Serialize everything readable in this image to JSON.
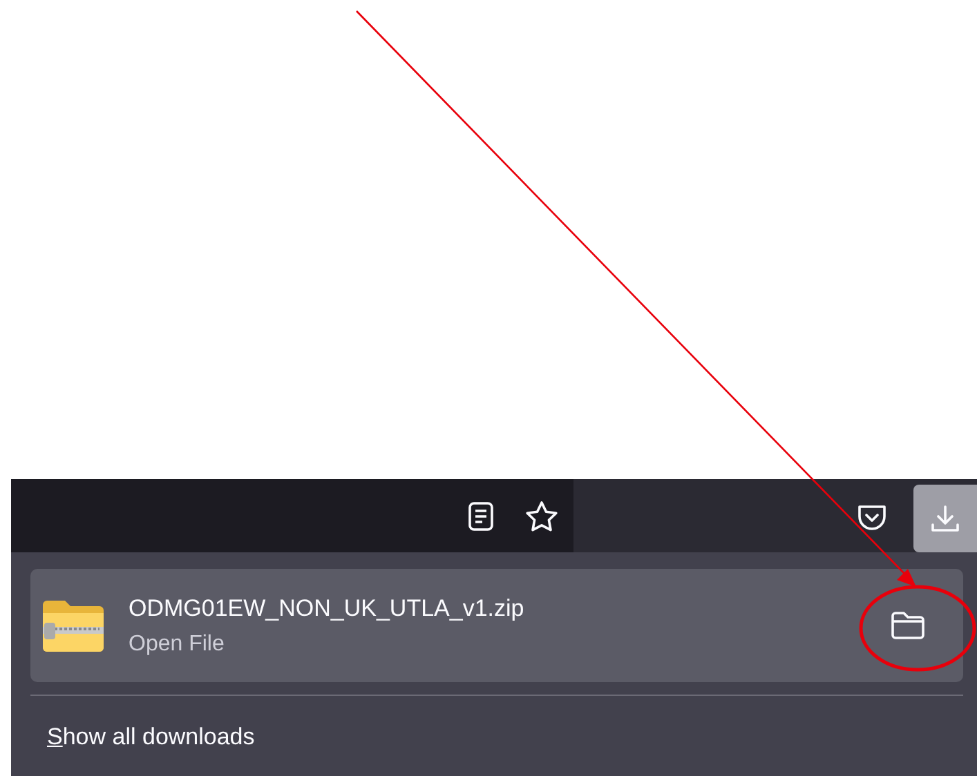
{
  "toolbar": {
    "buttons": [
      {
        "kind": "reader",
        "selected": false
      },
      {
        "kind": "bookmark",
        "selected": false
      },
      {
        "kind": "pocket",
        "selected": false
      },
      {
        "kind": "downloads",
        "selected": true
      }
    ]
  },
  "downloads_panel": {
    "items": [
      {
        "filename": "ODMG01EW_NON_UK_UTLA_v1.zip",
        "status": "Open File",
        "selected": true
      }
    ],
    "footer": {
      "label": "Show all downloads",
      "first_letter_underlined": true
    }
  }
}
